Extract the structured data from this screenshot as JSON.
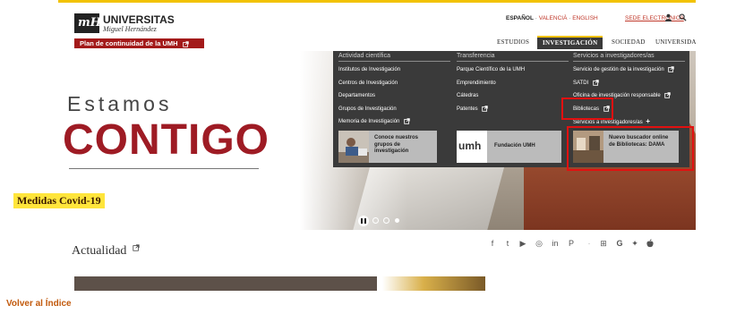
{
  "logo": {
    "title": "UNIVERSITAS",
    "subtitle": "Miguel Hernández",
    "mark": "mH"
  },
  "plan_button": "Plan de continuidad de la UMH",
  "top_links": {
    "lang_active": "ESPAÑOL",
    "sep": " · ",
    "lang_valencia": "VALENCIÀ",
    "lang_english": "ENGLISH",
    "sede": "SEDE ELECTRÓNICA"
  },
  "nav": [
    "ESTUDIOS",
    "INVESTIGACIÓN",
    "SOCIEDAD",
    "UNIVERSIDAD"
  ],
  "hero": {
    "line1": "Estamos",
    "line2": "CONTIGO",
    "covid": "Medidas Covid-19"
  },
  "mega_menu": {
    "col1": {
      "heading": "Actividad científica",
      "items": [
        "Institutos de Investigación",
        "Centros de Investigación",
        "Departamentos",
        "Grupos de Investigación",
        "Memoria de Investigación"
      ],
      "promo": "Conoce nuestros grupos de investigación"
    },
    "col2": {
      "heading": "Transferencia",
      "items": [
        "Parque Científico de la UMH",
        "Emprendimiento",
        "Cátedras",
        "Patentes"
      ],
      "promo": "Fundación UMH",
      "promo_logo": "umh"
    },
    "col3": {
      "heading": "Servicios a investigadores/as",
      "items": [
        "Servicio de gestión de la investigación",
        "SATDI",
        "Oficina de investigación responsable",
        "Bibliotecas",
        "Servicios a investigadores/as"
      ],
      "promo": "Nuevo buscador online de Bibliotecas: DAMA"
    }
  },
  "actualidad": "Actualidad",
  "social_icons": [
    "facebook-icon",
    "twitter-icon",
    "youtube-icon",
    "instagram-icon",
    "linkedin-icon",
    "pinterest-icon",
    "windows-icon",
    "google-icon",
    "android-icon",
    "apple-icon"
  ],
  "social_glyphs": [
    "f",
    "t",
    "▶",
    "◎",
    "in",
    "P",
    "⊞",
    "G",
    "✦",
    ""
  ],
  "footer_link": "Volver al Índice",
  "colors": {
    "accent_yellow": "#f2c200",
    "brand_red": "#9e1b24",
    "menu_bg": "#3a3a3a",
    "highlight": "#e21010",
    "volver": "#c25a0d"
  }
}
